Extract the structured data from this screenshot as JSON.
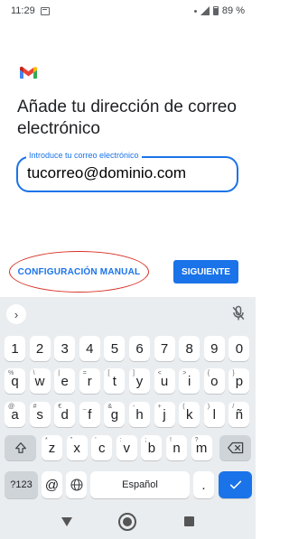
{
  "status_bar": {
    "time": "11:29",
    "battery": "89 %"
  },
  "heading": "Añade tu dirección de correo electrónico",
  "email": {
    "label": "Introduce tu correo electrónico",
    "value": "tucorreo@dominio.com"
  },
  "buttons": {
    "manual": "CONFIGURACIÓN MANUAL",
    "next": "SIGUIENTE"
  },
  "keyboard": {
    "number_row": [
      "1",
      "2",
      "3",
      "4",
      "5",
      "6",
      "7",
      "8",
      "9",
      "0"
    ],
    "row1": [
      {
        "key": "q",
        "hint": "%"
      },
      {
        "key": "w",
        "hint": "\\"
      },
      {
        "key": "e",
        "hint": "|"
      },
      {
        "key": "r",
        "hint": "="
      },
      {
        "key": "t",
        "hint": "["
      },
      {
        "key": "y",
        "hint": "]"
      },
      {
        "key": "u",
        "hint": "<"
      },
      {
        "key": "i",
        "hint": ">"
      },
      {
        "key": "o",
        "hint": "{"
      },
      {
        "key": "p",
        "hint": "}"
      }
    ],
    "row2": [
      {
        "key": "a",
        "hint": "@"
      },
      {
        "key": "s",
        "hint": "#"
      },
      {
        "key": "d",
        "hint": "€"
      },
      {
        "key": "f",
        "hint": "_"
      },
      {
        "key": "g",
        "hint": "&"
      },
      {
        "key": "h",
        "hint": "-"
      },
      {
        "key": "j",
        "hint": "+"
      },
      {
        "key": "k",
        "hint": "("
      },
      {
        "key": "l",
        "hint": ")"
      },
      {
        "key": "ñ",
        "hint": "/"
      }
    ],
    "row3": [
      {
        "key": "z",
        "hint": "*"
      },
      {
        "key": "x",
        "hint": "\""
      },
      {
        "key": "c",
        "hint": "'"
      },
      {
        "key": "v",
        "hint": ":"
      },
      {
        "key": "b",
        "hint": ";"
      },
      {
        "key": "n",
        "hint": "!"
      },
      {
        "key": "m",
        "hint": "?"
      }
    ],
    "symbols_key": "?123",
    "at_key": "@",
    "space_label": "Español",
    "period_key": ".",
    "icons": {
      "expand": "chevron-right-icon",
      "mic_off": "mic-off-icon",
      "shift": "shift-icon",
      "backspace": "backspace-icon",
      "globe": "globe-icon",
      "enter": "check-icon"
    }
  },
  "colors": {
    "accent": "#1a73e8",
    "annotation_red": "#d93025",
    "keyboard_bg": "#e9edf0"
  }
}
